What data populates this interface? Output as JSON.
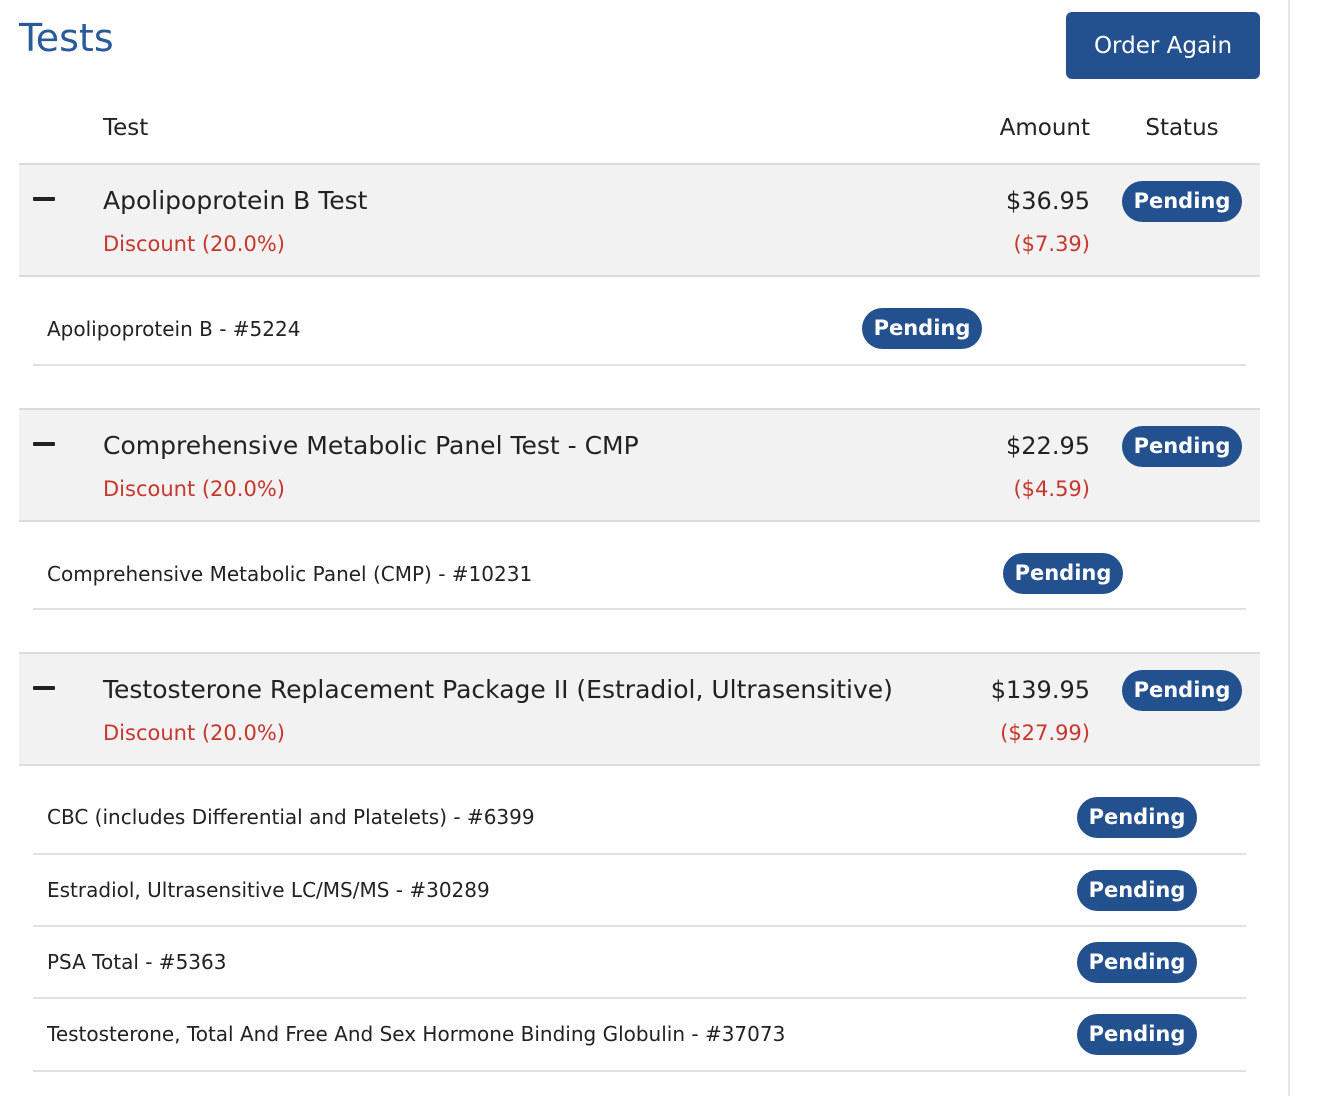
{
  "header": {
    "title": "Tests",
    "order_again_label": "Order Again"
  },
  "columns": {
    "test": "Test",
    "amount": "Amount",
    "status": "Status"
  },
  "groups": [
    {
      "name": "Apolipoprotein B Test",
      "discount_label": "Discount (20.0%)",
      "amount": "$36.95",
      "discount_amount": "($7.39)",
      "status": "Pending",
      "items": [
        {
          "name": "Apolipoprotein B - #5224",
          "status": "Pending"
        }
      ]
    },
    {
      "name": "Comprehensive Metabolic Panel Test - CMP",
      "discount_label": "Discount (20.0%)",
      "amount": "$22.95",
      "discount_amount": "($4.59)",
      "status": "Pending",
      "items": [
        {
          "name": "Comprehensive Metabolic Panel (CMP) - #10231",
          "status": "Pending"
        }
      ]
    },
    {
      "name": "Testosterone Replacement Package II (Estradiol, Ultrasensitive)",
      "discount_label": "Discount (20.0%)",
      "amount": "$139.95",
      "discount_amount": "($27.99)",
      "status": "Pending",
      "items": [
        {
          "name": "CBC (includes Differential and Platelets) - #6399",
          "status": "Pending"
        },
        {
          "name": "Estradiol, Ultrasensitive LC/MS/MS - #30289",
          "status": "Pending"
        },
        {
          "name": "PSA Total - #5363",
          "status": "Pending"
        },
        {
          "name": "Testosterone, Total And Free And Sex Hormone Binding Globulin - #37073",
          "status": "Pending"
        }
      ]
    }
  ],
  "colors": {
    "accent": "#23508e",
    "title": "#2a5a9a",
    "discount": "#c8372d",
    "group_background": "#f2f2f2"
  }
}
